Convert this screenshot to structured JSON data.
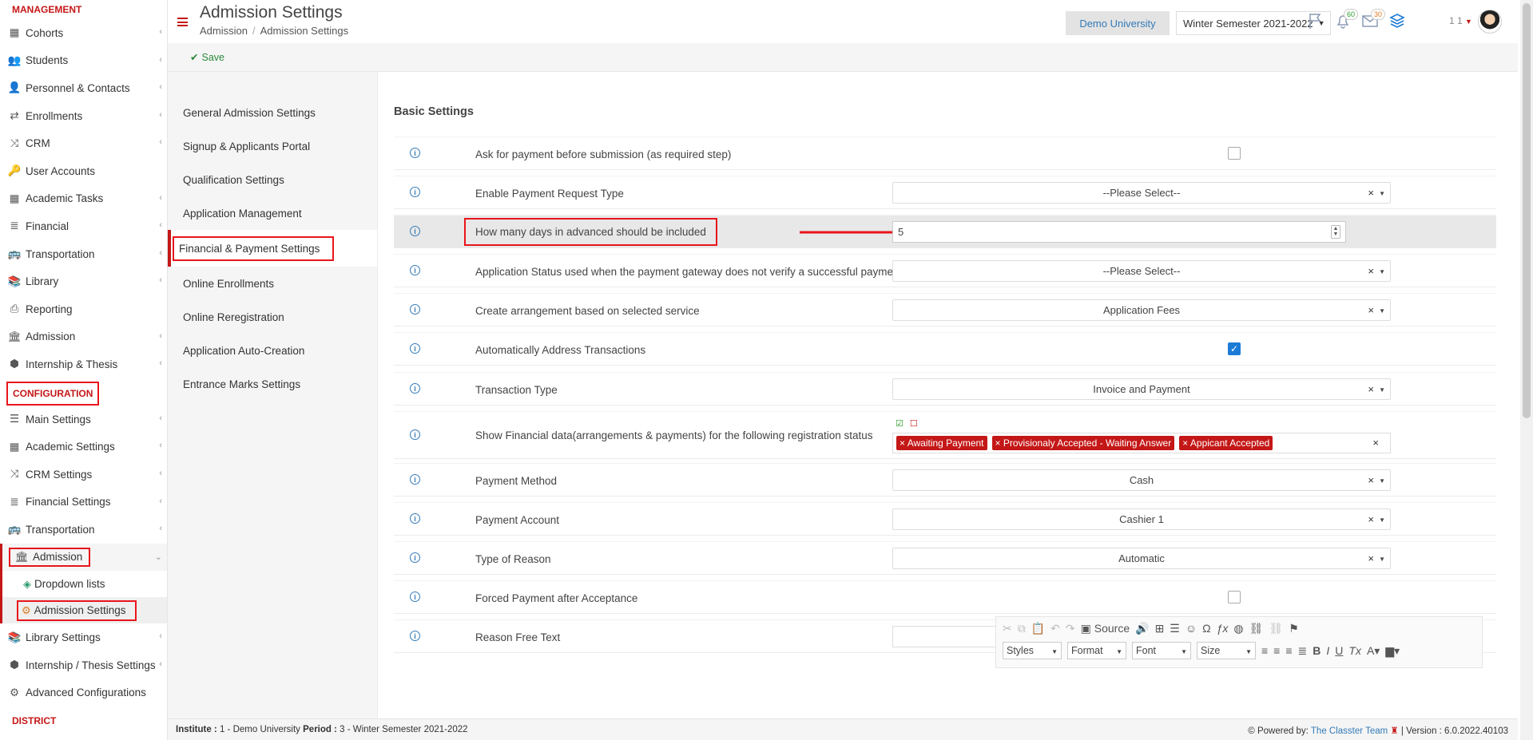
{
  "sidebar": {
    "management_label": "MANAGEMENT",
    "configuration_label": "CONFIGURATION",
    "district_label": "DISTRICT",
    "management_items": [
      {
        "label": "Cohorts"
      },
      {
        "label": "Students"
      },
      {
        "label": "Personnel & Contacts"
      },
      {
        "label": "Enrollments"
      },
      {
        "label": "CRM"
      },
      {
        "label": "User Accounts"
      },
      {
        "label": "Academic Tasks"
      },
      {
        "label": "Financial"
      },
      {
        "label": "Transportation"
      },
      {
        "label": "Library"
      },
      {
        "label": "Reporting"
      },
      {
        "label": "Admission"
      },
      {
        "label": "Internship & Thesis"
      }
    ],
    "configuration_items": [
      {
        "label": "Main Settings"
      },
      {
        "label": "Academic Settings"
      },
      {
        "label": "CRM Settings"
      },
      {
        "label": "Financial Settings"
      },
      {
        "label": "Transportation"
      },
      {
        "label": "Admission"
      },
      {
        "label": "Dropdown lists"
      },
      {
        "label": "Admission Settings"
      },
      {
        "label": "Library Settings"
      },
      {
        "label": "Internship / Thesis Settings"
      },
      {
        "label": "Advanced Configurations"
      }
    ]
  },
  "header": {
    "title": "Admission Settings",
    "breadcrumb": [
      "Admission",
      "Admission Settings"
    ],
    "university": "Demo University",
    "semester": "Winter Semester 2021-2022",
    "notif_count": "60",
    "mail_count": "30",
    "user_label": "1 1"
  },
  "toolbar": {
    "save_label": "Save"
  },
  "settings_menu": [
    "General Admission Settings",
    "Signup & Applicants Portal",
    "Qualification Settings",
    "Application Management",
    "Financial & Payment Settings",
    "Online Enrollments",
    "Online Reregistration",
    "Application Auto-Creation",
    "Entrance Marks Settings"
  ],
  "main": {
    "section_title": "Basic Settings",
    "rows": [
      {
        "label": "Ask for payment before submission (as required step)"
      },
      {
        "label": "Enable Payment Request Type",
        "value": "--Please Select--"
      },
      {
        "label": "How many days in advanced should be included",
        "value": "5"
      },
      {
        "label": "Application Status used when the payment gateway does not verify a successful payment immediately",
        "value": "--Please Select--"
      },
      {
        "label": "Create arrangement based on selected service",
        "value": "Application Fees"
      },
      {
        "label": "Automatically Address Transactions"
      },
      {
        "label": "Transaction Type",
        "value": "Invoice and Payment"
      },
      {
        "label": "Show Financial data(arrangements & payments) for the following registration status",
        "tags": [
          "Awaiting Payment",
          "Provisionaly Accepted - Waiting Answer",
          "Appicant Accepted"
        ]
      },
      {
        "label": "Payment Method",
        "value": "Cash"
      },
      {
        "label": "Payment Account",
        "value": "Cashier 1"
      },
      {
        "label": "Type of Reason",
        "value": "Automatic"
      },
      {
        "label": "Forced Payment after Acceptance"
      },
      {
        "label": "Reason Free Text"
      }
    ],
    "editor": {
      "source_label": "Source",
      "styles_label": "Styles",
      "format_label": "Format",
      "font_label": "Font",
      "size_label": "Size"
    }
  },
  "footer": {
    "institute_key": "Institute :",
    "institute_val": "1 - Demo University",
    "period_key": "Period :",
    "period_val": "3 - Winter Semester 2021-2022",
    "powered_by": "Powered by:",
    "team": "The Classter Team",
    "version": "| Version : 6.0.2022.40103"
  },
  "colors": {
    "accent": "#c41717",
    "highlight_box": "#e8151b",
    "link": "#337ab7",
    "check": "#1c7bd6"
  }
}
